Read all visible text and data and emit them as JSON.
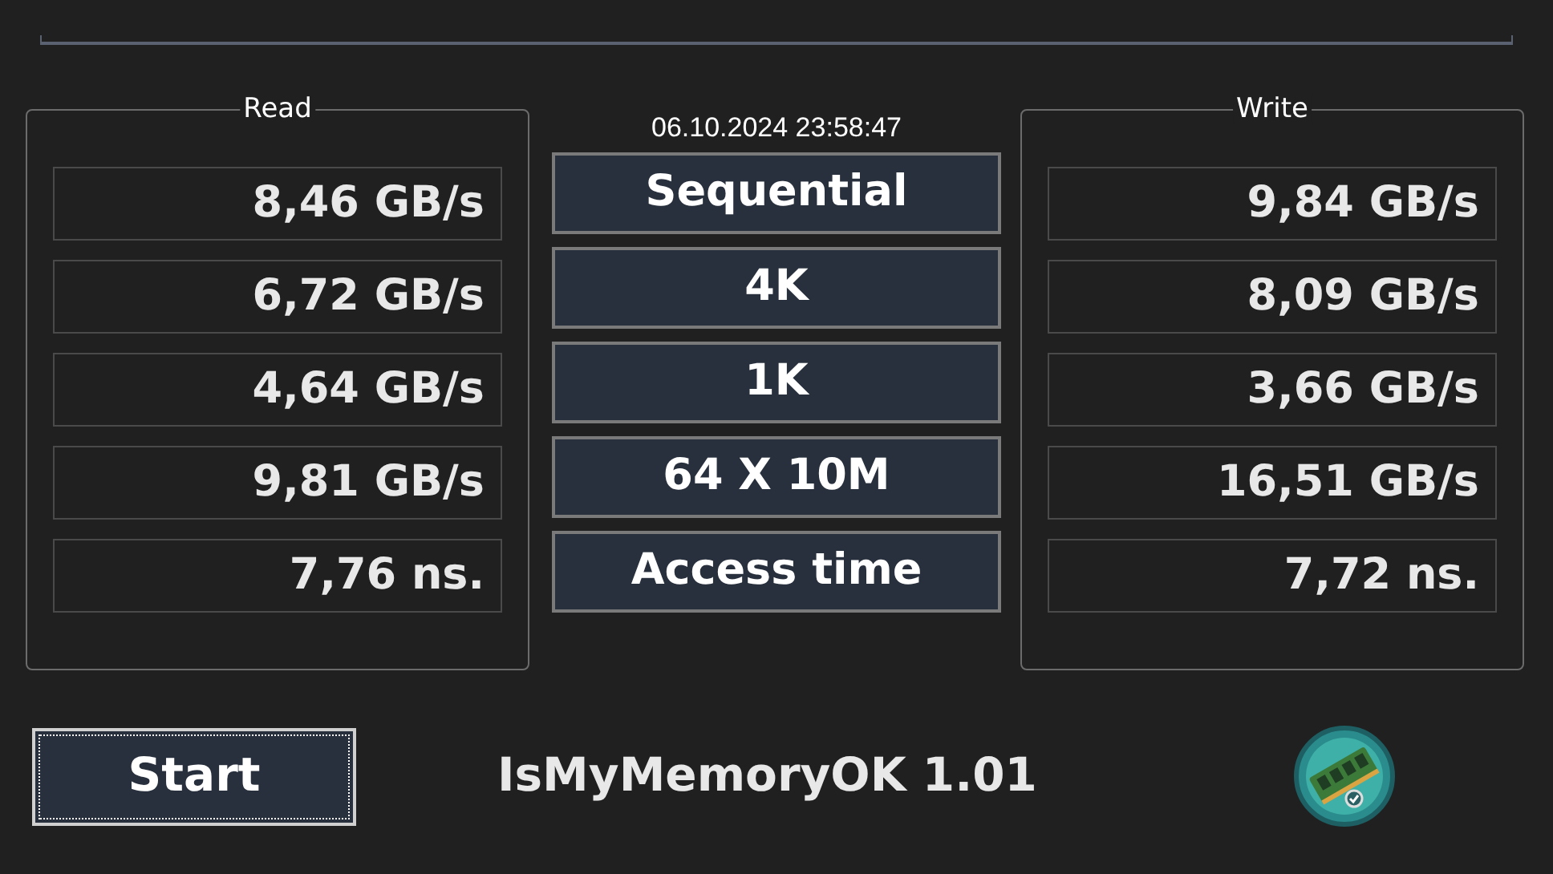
{
  "read": {
    "title": "Read",
    "values": [
      "8,46 GB/s",
      "6,72 GB/s",
      "4,64 GB/s",
      "9,81 GB/s",
      "7,76 ns."
    ]
  },
  "timestamp": "06.10.2024 23:58:47",
  "tests": [
    "Sequential",
    "4K",
    "1K",
    "64 X 10M",
    "Access time"
  ],
  "write": {
    "title": "Write",
    "values": [
      "9,84 GB/s",
      "8,09 GB/s",
      "3,66 GB/s",
      "16,51 GB/s",
      "7,72 ns."
    ]
  },
  "start_button": "Start",
  "app_title": "IsMyMemoryOK 1.01"
}
